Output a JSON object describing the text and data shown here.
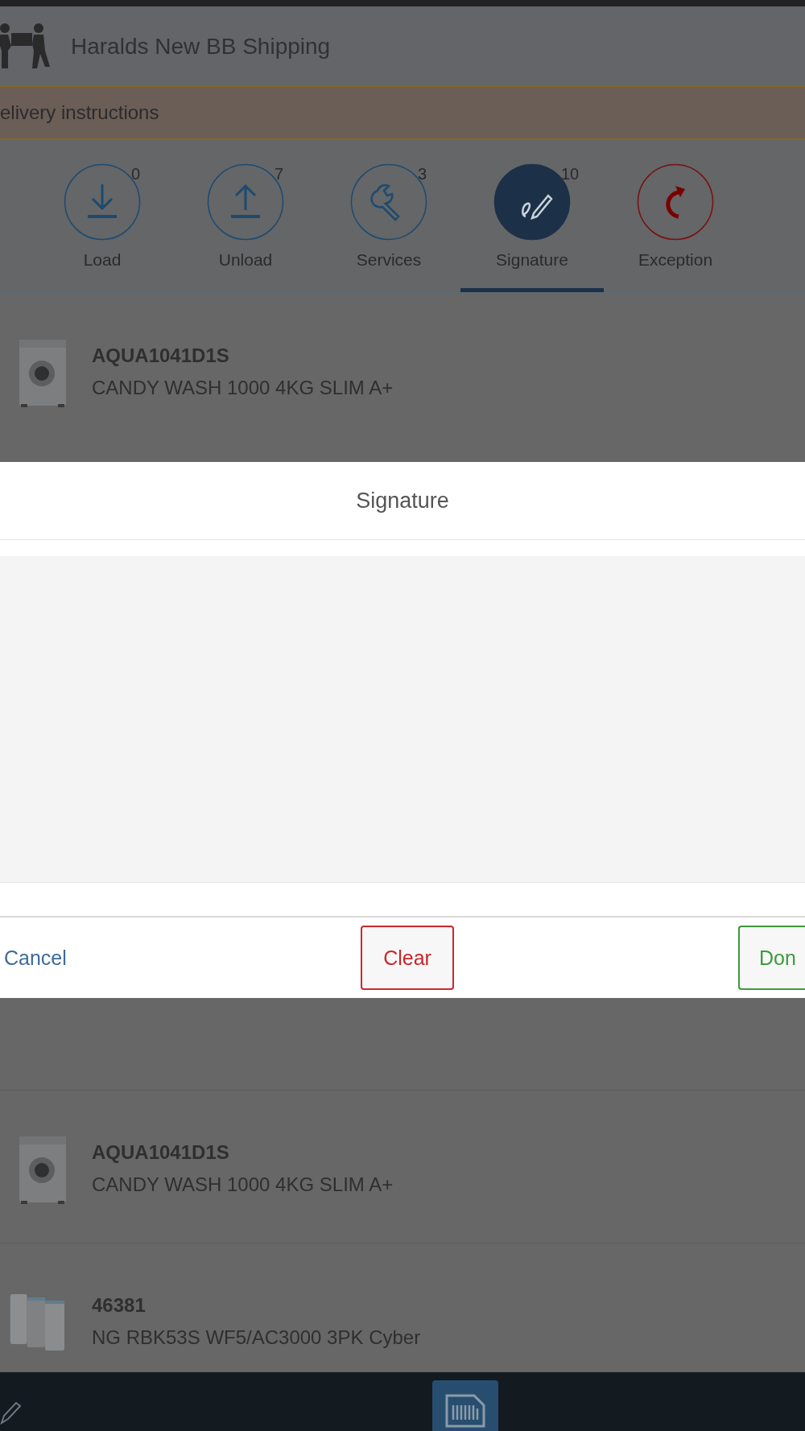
{
  "header": {
    "title": "Haralds New BB Shipping"
  },
  "banner": {
    "text": "elivery instructions"
  },
  "tabs": [
    {
      "kind": "load",
      "label": "Load",
      "count": "0",
      "selected": false
    },
    {
      "kind": "unload",
      "label": "Unload",
      "count": "7",
      "selected": false
    },
    {
      "kind": "services",
      "label": "Services",
      "count": "3",
      "selected": false
    },
    {
      "kind": "signature",
      "label": "Signature",
      "count": "10",
      "selected": true
    },
    {
      "kind": "exception",
      "label": "Exception",
      "selected": false
    }
  ],
  "items": [
    {
      "kind": "washer",
      "code": "AQUA1041D1S",
      "description": "CANDY WASH 1000 4KG SLIM A+"
    },
    {
      "kind": "washer",
      "code": "AQUA1041D1S",
      "description": "CANDY WASH 1000 4KG SLIM A+"
    },
    {
      "kind": "router",
      "code": "46381",
      "description": "NG RBK53S WF5/AC3000 3PK Cyber"
    }
  ],
  "dialog": {
    "title": "Signature",
    "buttons": [
      {
        "kind": "cancel",
        "label": "Cancel"
      },
      {
        "kind": "clear",
        "label": "Clear"
      },
      {
        "kind": "done",
        "label": "Don"
      }
    ]
  }
}
